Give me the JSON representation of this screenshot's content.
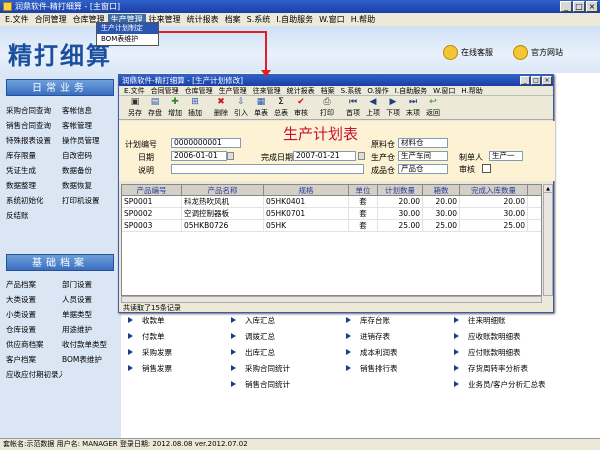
{
  "app": {
    "title": "润鼎软件-精打细算 - [主窗口]"
  },
  "menu": [
    "E.文件",
    "合同管理",
    "仓库管理",
    "生产管理",
    "往来管理",
    "统计报表",
    "档案",
    "S.系统",
    "I.自助服务",
    "W.窗口",
    "H.帮助"
  ],
  "dropdown": [
    "生产计划制定",
    "BOM表维护"
  ],
  "banner": {
    "logo": "精打细算",
    "online_service": "在线客服",
    "website": "官方网站"
  },
  "left": {
    "section1": "日常业务",
    "items1": [
      "采购合同查询",
      "客帐信息",
      "销售合同查询",
      "客帐管理",
      "特殊报表设置",
      "操作员管理",
      "库存限量",
      "自改密码",
      "凭证生成",
      "数据备份",
      "数据整理",
      "数据恢复",
      "系统初始化",
      "打印机设置",
      "反结账",
      ""
    ],
    "section2": "基础档案",
    "items2": [
      "产品档案",
      "部门设置",
      "大类设置",
      "人员设置",
      "小类设置",
      "单据类型",
      "仓库设置",
      "用途维护",
      "供应商档案",
      "收付款单类型",
      "客户档案",
      "BOM表维护",
      "应收应付期初录入",
      ""
    ]
  },
  "workarea": {
    "col1": [
      "收款单",
      "付款单",
      "采购发票",
      "销售发票"
    ],
    "col2": [
      "入库汇总",
      "调拨汇总",
      "出库汇总",
      "采购合同统计",
      "销售合同统计"
    ],
    "col3": [
      "库存台账",
      "进销存表",
      "成本利润表",
      "销售排行表"
    ],
    "col4": [
      "往来明细账",
      "应收账款明细表",
      "应付账款明细表",
      "存货周转率分析表",
      "业务员/客户分析汇总表"
    ]
  },
  "statusbar": "套帐名:示范数据   用户名: MANAGER   登录日期: 2012.08.08    ver.2012.07.02",
  "dialog": {
    "title": "润鼎软件-精打细算 - [生产计划修改]",
    "menu": [
      "E.文件",
      "合同管理",
      "仓库管理",
      "生产管理",
      "往来管理",
      "统计报表",
      "档案",
      "S.系统",
      "O.操作",
      "I.自助服务",
      "W.窗口",
      "H.帮助"
    ],
    "toolbar": [
      "另存",
      "存盘",
      "增加",
      "插加",
      "删除",
      "引入",
      "单表",
      "总表",
      "审核",
      "打印",
      "首项",
      "上项",
      "下项",
      "末项",
      "返回"
    ],
    "form": {
      "heading": "生产计划表",
      "plan_no_label": "计划编号",
      "plan_no": "0000000001",
      "date_label": "日期",
      "date": "2006-01-01",
      "finish_label": "完成日期",
      "finish": "2007-01-21",
      "note_label": "说明",
      "note": "",
      "raw_wh_label": "原料仓",
      "raw_wh": "材料仓",
      "prod_wh_label": "生产仓",
      "prod_wh": "生产车间",
      "fin_wh_label": "成品仓",
      "fin_wh": "产品仓",
      "maker_label": "制单人",
      "maker": "生产一",
      "audit_label": "审核"
    },
    "grid": {
      "headers": [
        "产品编号",
        "产品名称",
        "规格",
        "单位",
        "计划数量",
        "箱数",
        "完成入库数量"
      ],
      "rows": [
        [
          "SP0001",
          "科龙热吹风机",
          "05HK0401",
          "套",
          "20.00",
          "20.00",
          "20.00"
        ],
        [
          "SP0002",
          "空调控制器板",
          "05HK0701",
          "套",
          "30.00",
          "30.00",
          "30.00"
        ],
        [
          "SP0003",
          "05HKB0726",
          "05HK",
          "套",
          "25.00",
          "25.00",
          "25.00"
        ]
      ]
    },
    "status": "共读取了15条记录"
  }
}
